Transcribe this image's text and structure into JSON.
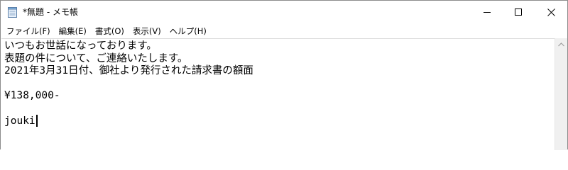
{
  "window": {
    "title": "*無題 - メモ帳"
  },
  "menu": {
    "items": [
      {
        "label": "ファイル(F)"
      },
      {
        "label": "編集(E)"
      },
      {
        "label": "書式(O)"
      },
      {
        "label": "表示(V)"
      },
      {
        "label": "ヘルプ(H)"
      }
    ]
  },
  "editor": {
    "lines": [
      "いつもお世話になっております。",
      "表題の件について、ご連絡いたします。",
      "2021年3月31日付、御社より発行された請求書の額面",
      "",
      "¥138,000-",
      "",
      "jouki"
    ]
  },
  "icons": {
    "app": "notepad-icon",
    "minimize": "minimize-icon",
    "maximize": "maximize-icon",
    "close": "close-icon",
    "scroll_up": "scroll-up-arrow-icon"
  }
}
